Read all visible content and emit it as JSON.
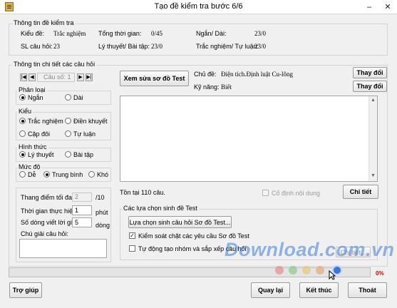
{
  "window": {
    "title": "Tạo đề kiểm tra bước 6/6",
    "minimize": "–",
    "close": "✕"
  },
  "test_info": {
    "title": "Thông tin đề kiểm tra",
    "kieu_de_label": "Kiểu đề:",
    "kieu_de_value": "Trắc nghiệm",
    "sl_cau_hoi_label": "SL câu hỏi:",
    "sl_cau_hoi_value": "23",
    "tong_thoi_gian_label": "Tổng thời gian:",
    "tong_thoi_gian_value": "0/45",
    "ly_thuyet_label": "Lý thuyết/ Bài tập:",
    "ly_thuyet_value": "23/0",
    "ngan_dai_label": "Ngắn/ Dài:",
    "ngan_dai_value": "23/0",
    "tn_tl_label": "Trắc nghiệm/ Tự luận:",
    "tn_tl_value": "23/0"
  },
  "question_detail": {
    "title": "Thông tin chi tiết các câu hỏi",
    "cau_so_label": "Câu số: 1",
    "phan_loai": {
      "title": "Phân loại",
      "options": [
        "Ngắn",
        "Dài"
      ]
    },
    "kieu": {
      "title": "Kiểu",
      "options": [
        "Trắc nghiệm",
        "Điền khuyết",
        "Cặp đôi",
        "Tự luận"
      ]
    },
    "hinh_thuc": {
      "title": "Hình thức",
      "options": [
        "Lý thuyết",
        "Bài tập"
      ]
    },
    "muc_do": {
      "title": "Mức độ",
      "options": [
        "Dễ",
        "Trung bình",
        "Khó"
      ]
    },
    "thang_diem_label": "Thang điểm tối đa:",
    "thang_diem_value": "2",
    "thang_diem_suffix": "/10",
    "thoi_gian_label": "Thời gian thực hiện:",
    "thoi_gian_value": "1",
    "thoi_gian_unit": "phút",
    "so_dong_label": "Số dòng viết lời giải:",
    "so_dong_value": "5",
    "so_dong_unit": "dòng",
    "chu_giai_label": "Chú giải câu hỏi:"
  },
  "right_panel": {
    "xem_sua_button": "Xem sửa sơ đồ Test",
    "chu_de_label": "Chủ đề:",
    "chu_de_value": "Điện tích.Định luật Cu-lông",
    "ky_nang_label": "Kỹ năng:",
    "ky_nang_value": "Biết",
    "thay_doi_button": "Thay đổi",
    "ton_tai_text": "Tồn tại 110 câu.",
    "co_dinh_label": "Cố định nội dung",
    "chi_tiet_button": "Chi tiết",
    "gen_options_title": "Các lựa chọn sinh đề Test",
    "lua_chon_button": "Lựa chọn sinh câu hỏi Sơ đồ Test...",
    "kiem_soat_label": "Kiểm soát chặt các yêu cầu Sơ đồ Test",
    "tu_dong_label": "Tự động tạo nhóm và sắp xếp câu hỏi",
    "chi_tiet_small_button": "Chi tiết..."
  },
  "progress": {
    "percent_text": "0%",
    "value": 0
  },
  "watermark": {
    "text": "Download.com.vn"
  },
  "footer": {
    "help_button": "Trợ giúp",
    "back_button": "Quay lại",
    "finish_button": "Kết thúc",
    "exit_button": "Thoát"
  },
  "colors": {
    "progress_text": "#cc0000",
    "watermark": "#3e7fd8"
  }
}
